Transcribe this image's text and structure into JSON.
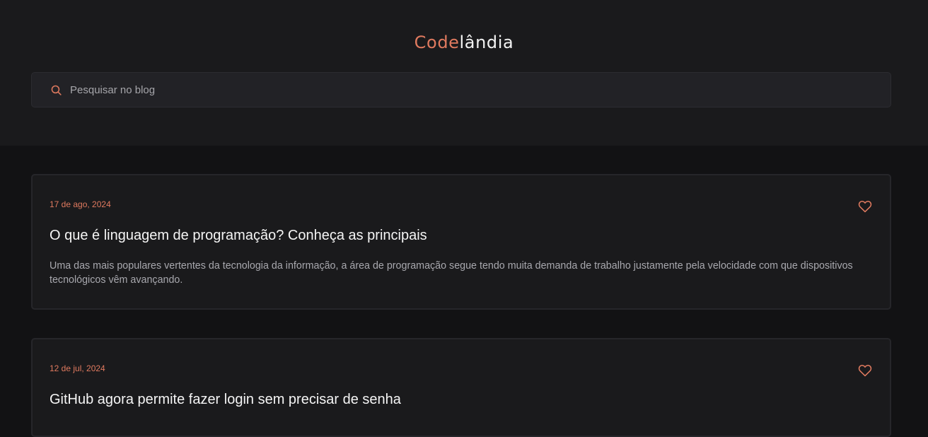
{
  "header": {
    "logo_accent": "Code",
    "logo_rest": "lândia"
  },
  "search": {
    "placeholder": "Pesquisar no blog",
    "value": ""
  },
  "posts": [
    {
      "date": "17 de ago, 2024",
      "title": "O que é linguagem de programação? Conheça as principais",
      "excerpt": "Uma das mais populares vertentes da tecnologia da informação, a área de programação segue tendo muita demanda de trabalho justamente pela velocidade com que dispositivos tecnológicos vêm avançando.",
      "like_icon": "heart-icon"
    },
    {
      "date": "12 de jul, 2024",
      "title": "GitHub agora permite fazer login sem precisar de senha",
      "like_icon": "heart-icon"
    }
  ],
  "colors": {
    "accent": "#e07a5f",
    "background": "#121214",
    "surface": "#1a1a1c",
    "input": "#222226"
  }
}
